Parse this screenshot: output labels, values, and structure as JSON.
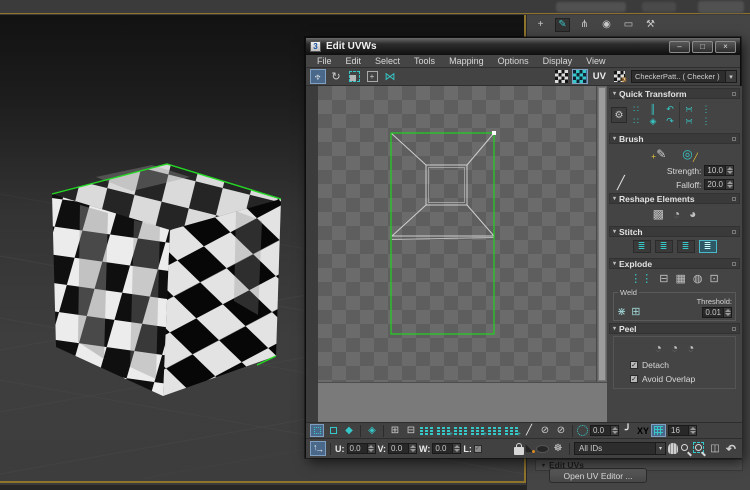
{
  "ui": {
    "rollout_arrow": "▾",
    "dropdown_arrow": "▾",
    "check_glyph": "✓"
  },
  "colors": {
    "uv_green": "#21d421",
    "accent_teal": "#36c8c8",
    "selection_blue": "#49688a",
    "viewport_border_amber": "#8f742c"
  },
  "window": {
    "title": "Edit UVWs",
    "icon_text": "3",
    "minimize": "–",
    "maximize": "□",
    "close": "×"
  },
  "menus": [
    "File",
    "Edit",
    "Select",
    "Tools",
    "Mapping",
    "Options",
    "Display",
    "View"
  ],
  "toolbar": {
    "uv_label": "UV",
    "material_selector": "CheckerPatt.. ( Checker )"
  },
  "icons": {
    "rotate": "↻",
    "mirror": "⋈",
    "gear": "⚙",
    "pen": "╱",
    "line": "╱",
    "strike": "⊘",
    "falloff_curve": "╯",
    "grow": "⊞",
    "shrink": "⊟",
    "face": "◆",
    "element": "◈",
    "wheel": "☸",
    "undo": "↶",
    "box3d": "◫",
    "pelt_triangle": "◣",
    "create_tab": "+",
    "modify_tab": "✎",
    "hierarchy_tab": "⋔",
    "motion_tab": "◉",
    "display_tab": "▭",
    "utilities_tab": "⚒",
    "brush_paint": "✎",
    "brush_relax": "◎",
    "brush_plus": "+",
    "brush_slash": "╱",
    "reshape_1": "▩",
    "reshape_2": "◔",
    "reshape_3": "◕",
    "stitch_glyph": "≣",
    "explode_1": "⋮⋮",
    "explode_2": "⊟",
    "explode_3": "▦",
    "explode_4": "◍",
    "explode_5": "⊡",
    "weld_1": "⋇",
    "weld_2": "⊞",
    "peel": "◔",
    "qt_1": "∷",
    "qt_2": "║",
    "qt_3": "↶",
    "qt_4": "∷",
    "qt_5": "◈",
    "qt_6": "↷",
    "qt_7": "∺",
    "qt_8": "⋮",
    "qt_9": "∺",
    "qt_10": "⋮",
    "arrow_h": "↔",
    "arrow_v": "↕",
    "gizmo_up": "↑",
    "gizmo_right": "→"
  },
  "panel": {
    "quick_transform": {
      "title": "Quick Transform"
    },
    "brush": {
      "title": "Brush",
      "strength_label": "Strength:",
      "strength_value": "10.0",
      "falloff_label": "Falloff:",
      "falloff_value": "20.0"
    },
    "reshape": {
      "title": "Reshape Elements"
    },
    "stitch": {
      "title": "Stitch"
    },
    "explode": {
      "title": "Explode",
      "weld_label": "Weld",
      "threshold_label": "Threshold:",
      "threshold_value": "0.01"
    },
    "peel": {
      "title": "Peel",
      "detach_label": "Detach",
      "avoid_overlap_label": "Avoid Overlap"
    }
  },
  "statusbar": {
    "angle_value": "0.0",
    "xy_label": "XY",
    "grid_value": "16",
    "u_label": "U:",
    "u_value": "0.0",
    "v_label": "V:",
    "v_value": "0.0",
    "w_label": "W:",
    "w_value": "0.0",
    "l_label": "L:",
    "all_ids": "All IDs"
  },
  "command_panel": {
    "edit_uvs_title": "Edit UVs",
    "open_uv_editor_button": "Open UV Editor ..."
  }
}
